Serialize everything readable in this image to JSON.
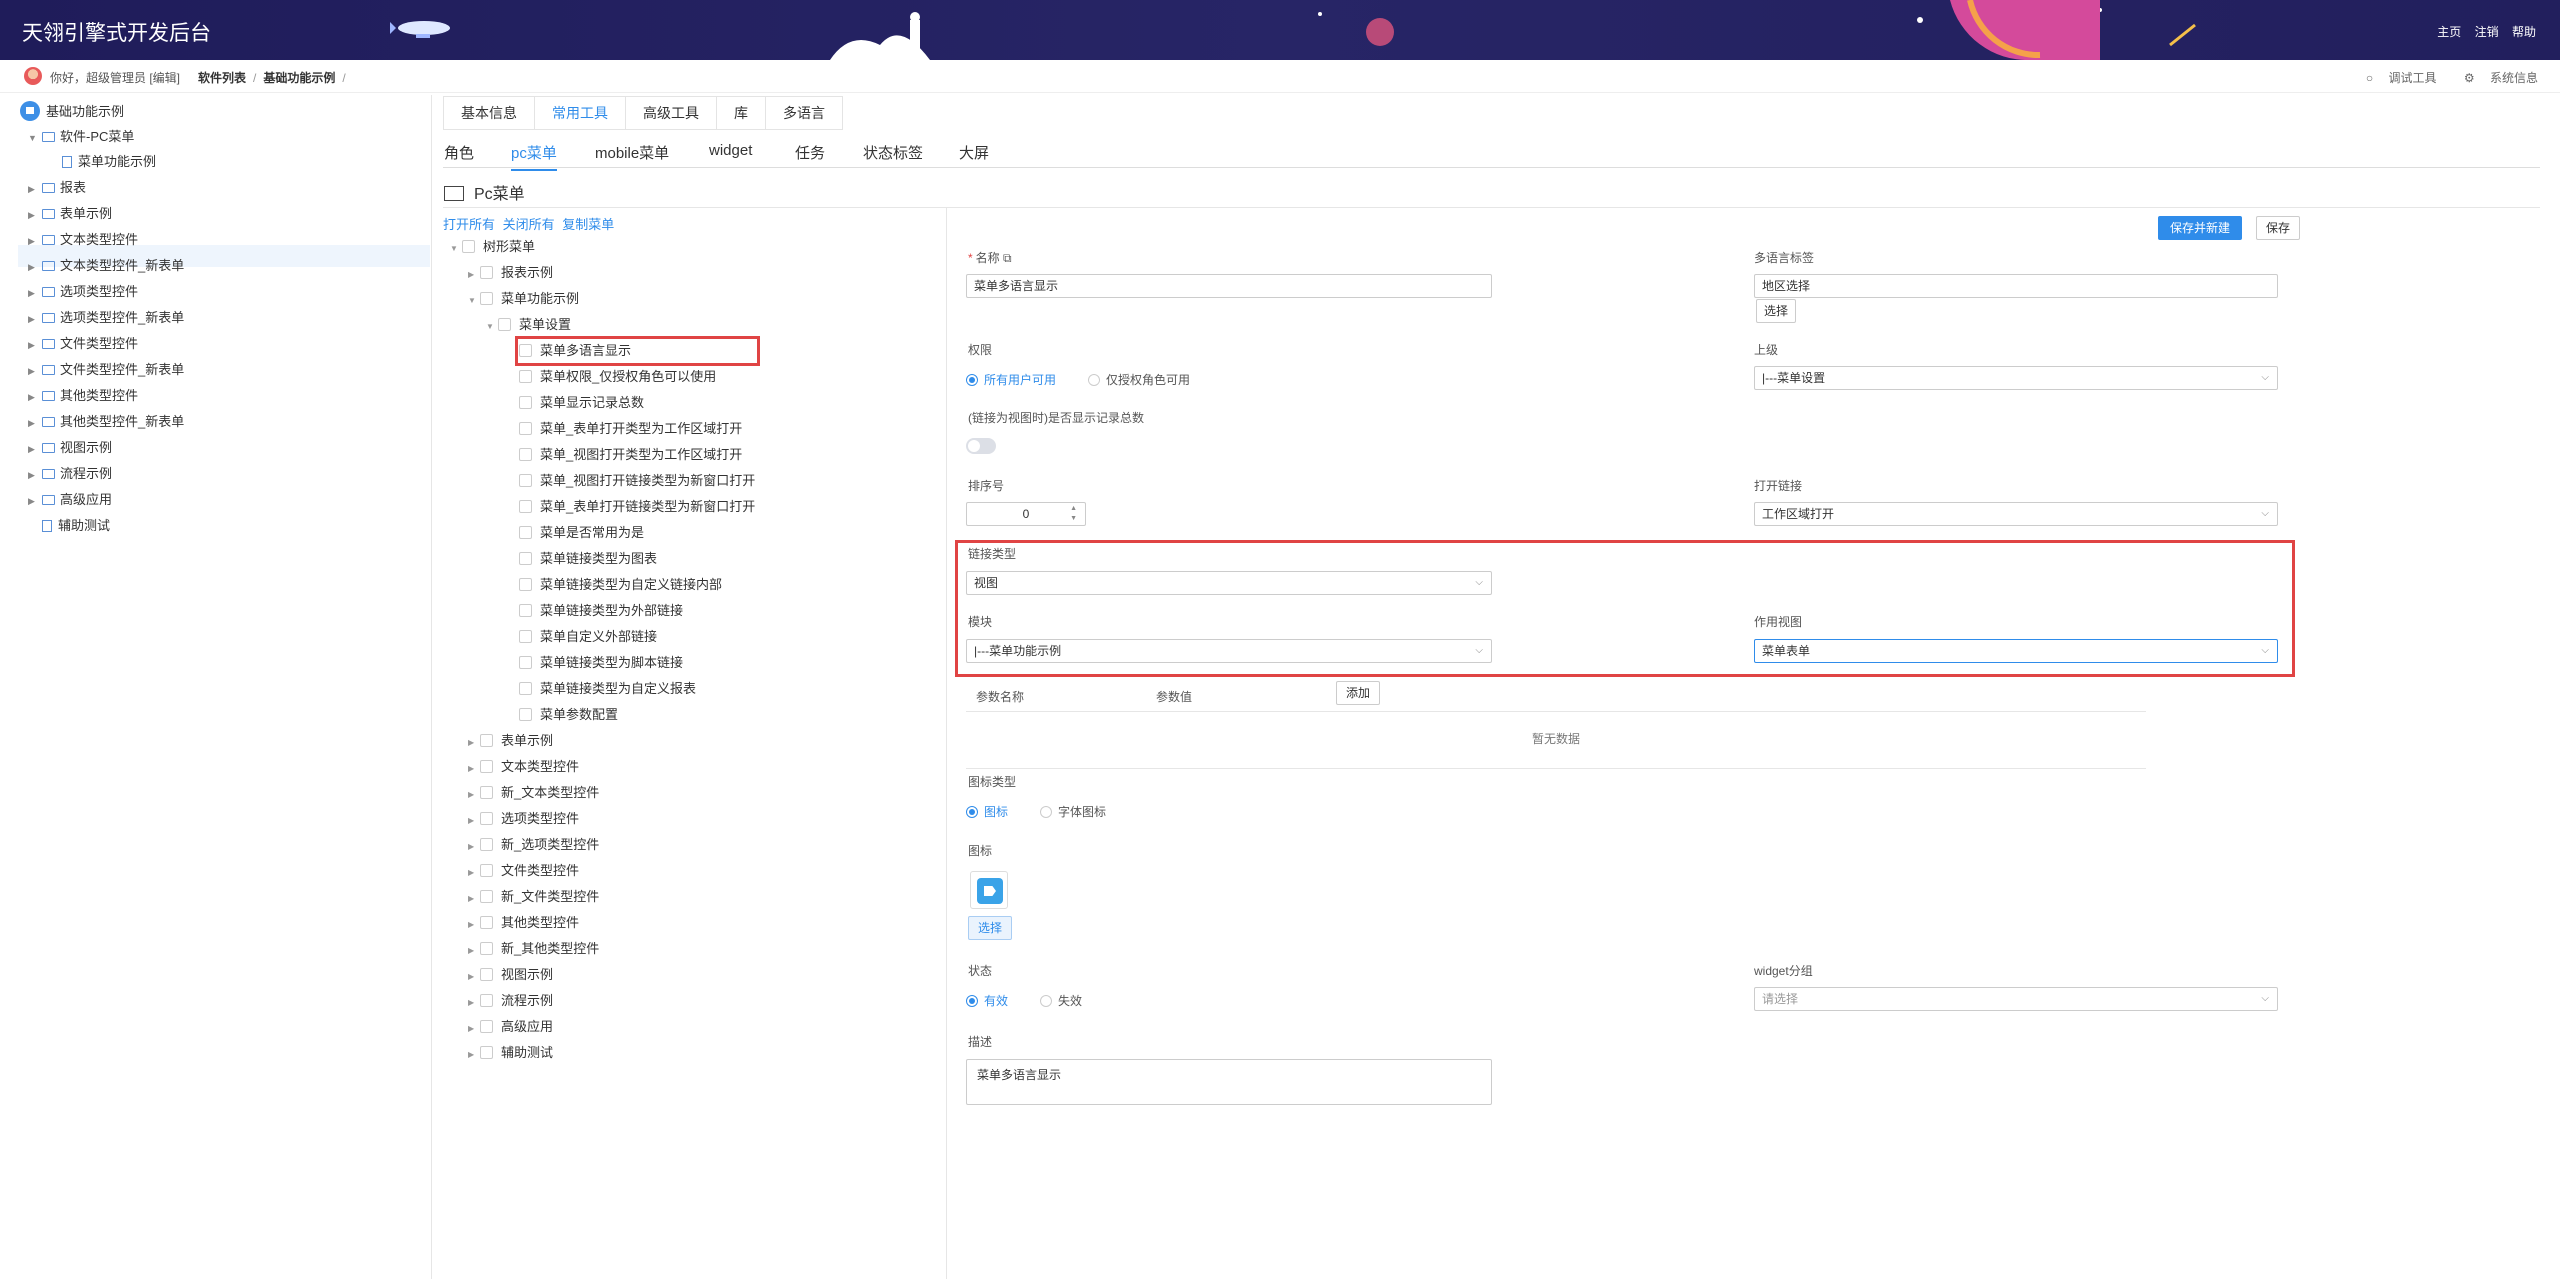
{
  "header": {
    "brand": "天翎引擎式开发后台",
    "links": [
      "主页",
      "注销",
      "帮助"
    ]
  },
  "subbar": {
    "greeting": "你好，超级管理员 [编辑]",
    "breadcrumbs": [
      "软件列表",
      "基础功能示例"
    ],
    "breadcrumb_sep": "/",
    "right": [
      "调试工具",
      "系统信息"
    ]
  },
  "left_tree": {
    "root": "基础功能示例",
    "items": [
      {
        "label": "软件-PC菜单",
        "expanded": true
      },
      {
        "label": "菜单功能示例",
        "selected": true
      },
      {
        "label": "报表"
      },
      {
        "label": "表单示例"
      },
      {
        "label": "文本类型控件"
      },
      {
        "label": "文本类型控件_新表单"
      },
      {
        "label": "选项类型控件"
      },
      {
        "label": "选项类型控件_新表单"
      },
      {
        "label": "文件类型控件"
      },
      {
        "label": "文件类型控件_新表单"
      },
      {
        "label": "其他类型控件"
      },
      {
        "label": "其他类型控件_新表单"
      },
      {
        "label": "视图示例"
      },
      {
        "label": "流程示例"
      },
      {
        "label": "高级应用"
      },
      {
        "label": "辅助测试"
      }
    ]
  },
  "tabs_top": [
    "基本信息",
    "常用工具",
    "高级工具",
    "库",
    "多语言"
  ],
  "tabs_top_active": "常用工具",
  "tabs_second": [
    "角色",
    "pc菜单",
    "mobile菜单",
    "widget",
    "任务",
    "状态标签",
    "大屏"
  ],
  "tabs_second_active": "pc菜单",
  "page_title": "Pc菜单",
  "tree_links": [
    "打开所有",
    "关闭所有",
    "复制菜单"
  ],
  "menu_tree": {
    "root": "树形菜单",
    "items": [
      {
        "label": "报表示例",
        "level": 1
      },
      {
        "label": "菜单功能示例",
        "level": 1,
        "expanded": true
      },
      {
        "label": "菜单设置",
        "level": 2,
        "expanded": true
      },
      {
        "label": "菜单多语言显示",
        "level": 3,
        "highlighted": true
      },
      {
        "label": "菜单权限_仅授权角色可以使用",
        "level": 3
      },
      {
        "label": "菜单显示记录总数",
        "level": 3
      },
      {
        "label": "菜单_表单打开类型为工作区域打开",
        "level": 3
      },
      {
        "label": "菜单_视图打开类型为工作区域打开",
        "level": 3
      },
      {
        "label": "菜单_视图打开链接类型为新窗口打开",
        "level": 3
      },
      {
        "label": "菜单_表单打开链接类型为新窗口打开",
        "level": 3
      },
      {
        "label": "菜单是否常用为是",
        "level": 3
      },
      {
        "label": "菜单链接类型为图表",
        "level": 3
      },
      {
        "label": "菜单链接类型为自定义链接内部",
        "level": 3
      },
      {
        "label": "菜单链接类型为外部链接",
        "level": 3
      },
      {
        "label": "菜单自定义外部链接",
        "level": 3
      },
      {
        "label": "菜单链接类型为脚本链接",
        "level": 3
      },
      {
        "label": "菜单链接类型为自定义报表",
        "level": 3
      },
      {
        "label": "菜单参数配置",
        "level": 3
      },
      {
        "label": "表单示例",
        "level": 1
      },
      {
        "label": "文本类型控件",
        "level": 1
      },
      {
        "label": "新_文本类型控件",
        "level": 1
      },
      {
        "label": "选项类型控件",
        "level": 1
      },
      {
        "label": "新_选项类型控件",
        "level": 1
      },
      {
        "label": "文件类型控件",
        "level": 1
      },
      {
        "label": "新_文件类型控件",
        "level": 1
      },
      {
        "label": "其他类型控件",
        "level": 1
      },
      {
        "label": "新_其他类型控件",
        "level": 1
      },
      {
        "label": "视图示例",
        "level": 1
      },
      {
        "label": "流程示例",
        "level": 1
      },
      {
        "label": "高级应用",
        "level": 1
      },
      {
        "label": "辅助测试",
        "level": 1
      }
    ]
  },
  "form": {
    "save_new_label": "保存并新建",
    "save_label": "保存",
    "name_label": "名称",
    "name_value": "菜单多语言显示",
    "i18n_label": "多语言标签",
    "i18n_value": "地区选择",
    "i18n_select_btn": "选择",
    "perm_label": "权限",
    "perm_options": [
      "所有用户可用",
      "仅授权角色可用"
    ],
    "parent_label": "上级",
    "parent_value": "|---菜单设置",
    "show_count_label": "(链接为视图时)是否显示记录总数",
    "order_label": "排序号",
    "order_value": "0",
    "open_label": "打开链接",
    "open_value": "工作区域打开",
    "link_type_label": "链接类型",
    "link_type_value": "视图",
    "module_label": "模块",
    "module_value": "|---菜单功能示例",
    "view_label": "作用视图",
    "view_value": "菜单表单",
    "param_name_col": "参数名称",
    "param_value_col": "参数值",
    "add_btn": "添加",
    "empty_text": "暂无数据",
    "icon_type_label": "图标类型",
    "icon_type_options": [
      "图标",
      "字体图标"
    ],
    "icon_label": "图标",
    "icon_select_btn": "选择",
    "status_label": "状态",
    "status_options": [
      "有效",
      "失效"
    ],
    "widget_group_label": "widget分组",
    "widget_group_placeholder": "请选择",
    "desc_label": "描述",
    "desc_value": "菜单多语言显示"
  },
  "colors": {
    "header_bg": "#221f5d",
    "accent": "#2f8cea",
    "highlight_border": "#e04444"
  }
}
